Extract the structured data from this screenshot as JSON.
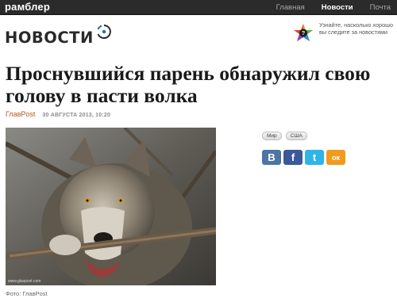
{
  "topbar": {
    "brand": "рамблер",
    "nav": [
      {
        "label": "Главная",
        "active": false
      },
      {
        "label": "Новости",
        "active": true
      },
      {
        "label": "Почта",
        "active": false
      }
    ]
  },
  "section": {
    "title": "НОВОСТИ"
  },
  "promo": {
    "text": "Узнайте, насколько хорошо вы следите за новостями",
    "icon": "question-star-icon"
  },
  "article": {
    "headline": "Проснувшийся парень обнаружил свою голову в пасти волка",
    "source": "ГлавPost",
    "date": "30 АВГУСТА 2013, 10:20",
    "photo_caption": "Фото: ГлавPost",
    "photo_watermark": "www.glavpost.com"
  },
  "tags": [
    "Мир",
    "США"
  ],
  "share": [
    {
      "name": "vkontakte",
      "glyph": "В",
      "color": "#4c75a3"
    },
    {
      "name": "facebook",
      "glyph": "f",
      "color": "#3b5998"
    },
    {
      "name": "twitter",
      "glyph": "t",
      "color": "#2fb4e8"
    },
    {
      "name": "odnoklassniki",
      "glyph": "ок",
      "color": "#f19b1d"
    }
  ],
  "colors": {
    "topbar": "#2b2b2b",
    "source": "#b5571c",
    "accent_blue": "#1d6fae"
  }
}
